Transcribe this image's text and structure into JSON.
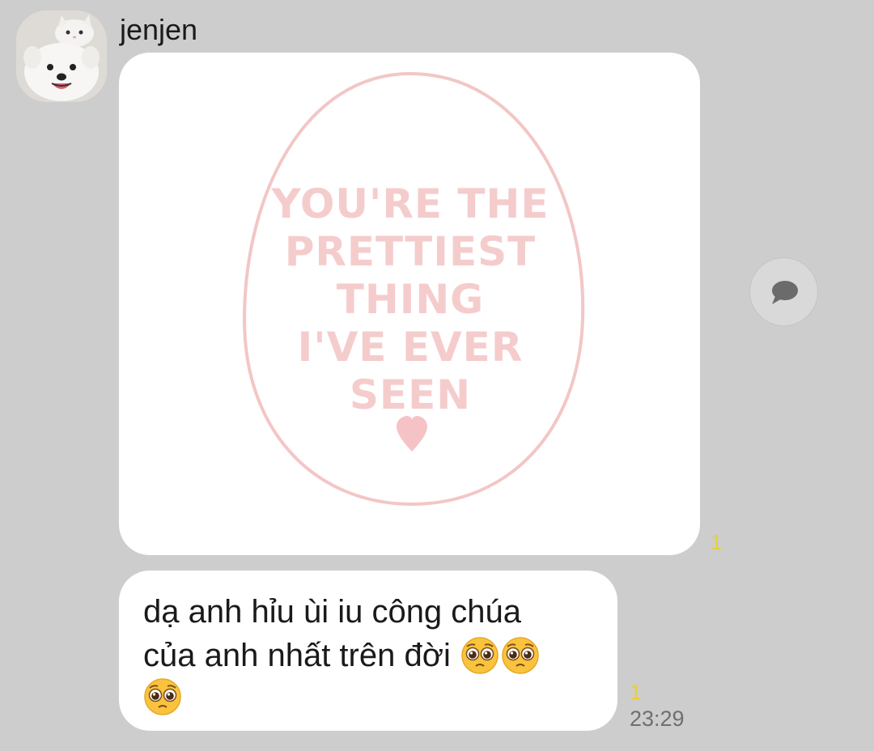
{
  "chat": {
    "sender_name": "jenjen",
    "avatar_icon": "dog-with-cat-avatar",
    "image_message": {
      "poster_lines": [
        "YOU'RE THE",
        "PRETTIEST",
        "THING",
        "I'VE EVER",
        "SEEN"
      ],
      "poster_color": "#f5cccc",
      "read_count": "1"
    },
    "text_message": {
      "line1": "dạ anh hỉu ùi iu công chúa",
      "line2": "của anh nhất trên đời",
      "emoji_icon": "pleading-face-emoji",
      "read_count": "1",
      "time": "23:29"
    },
    "share_icon": "speech-bubble-icon"
  },
  "colors": {
    "background": "#cdcdcd",
    "bubble": "#ffffff",
    "unread_count": "#e9cf3a",
    "timestamp": "#6f6f6f"
  }
}
